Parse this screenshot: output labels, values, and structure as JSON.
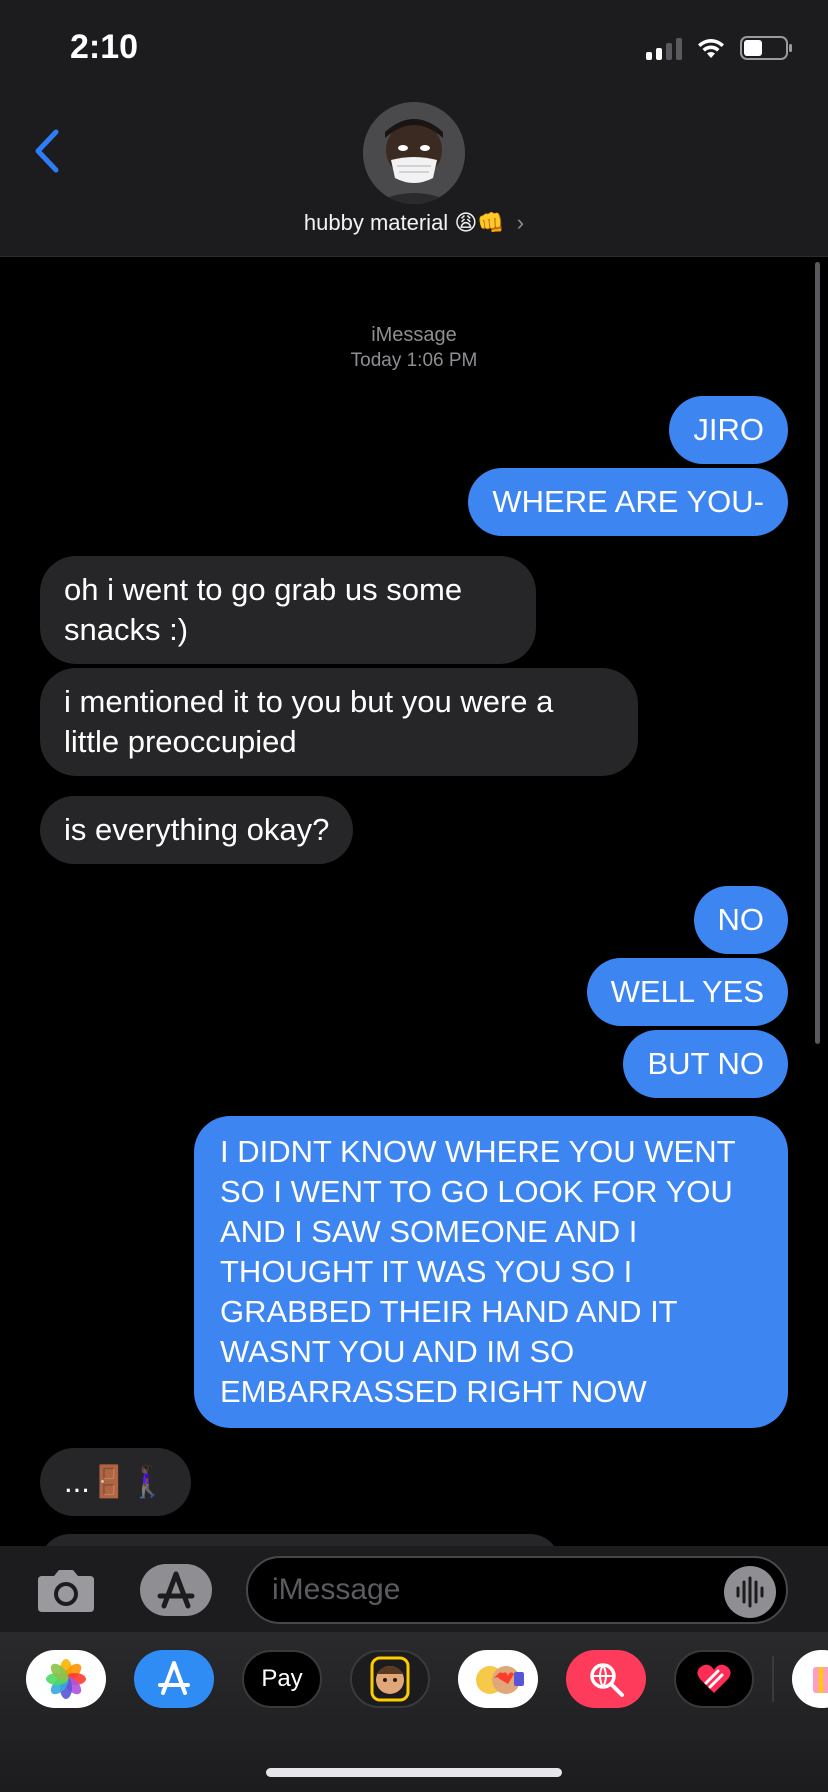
{
  "status_bar": {
    "time": "2:10"
  },
  "header": {
    "contact_name": "hubby material",
    "contact_emoji": "😩👊",
    "chevron": "›"
  },
  "thread": {
    "service": "iMessage",
    "timestamp": "Today 1:06 PM",
    "messages": [
      {
        "from": "me",
        "text": "JIRO"
      },
      {
        "from": "me",
        "text": "WHERE ARE YOU-"
      },
      {
        "from": "them",
        "text": "oh i went to go grab us some snacks :)"
      },
      {
        "from": "them",
        "text": "i mentioned it to you but you were a little preoccupied"
      },
      {
        "from": "them",
        "text": "is everything okay?"
      },
      {
        "from": "me",
        "text": "NO"
      },
      {
        "from": "me",
        "text": "WELL YES"
      },
      {
        "from": "me",
        "text": "BUT NO"
      },
      {
        "from": "me",
        "text": "I DIDNT KNOW WHERE YOU WENT SO I WENT TO GO LOOK FOR YOU AND I SAW SOMEONE AND I THOUGHT IT WAS YOU SO I GRABBED THEIR HAND AND IT WASNT YOU AND IM SO EMBARRASSED RIGHT NOW"
      },
      {
        "from": "them",
        "text": "...🚪🚶🏿‍♀️"
      }
    ]
  },
  "composer": {
    "placeholder": "iMessage"
  },
  "app_drawer": {
    "apps": [
      {
        "name": "photos-icon"
      },
      {
        "name": "app-store-icon"
      },
      {
        "name": "apple-pay-icon",
        "label": "Pay"
      },
      {
        "name": "memoji-icon"
      },
      {
        "name": "memoji-stickers-icon"
      },
      {
        "name": "search-images-icon"
      },
      {
        "name": "heart-sticker-icon"
      }
    ]
  },
  "colors": {
    "sent_bubble": "#3d85f0",
    "received_bubble": "#262628",
    "accent": "#2f7df6"
  }
}
